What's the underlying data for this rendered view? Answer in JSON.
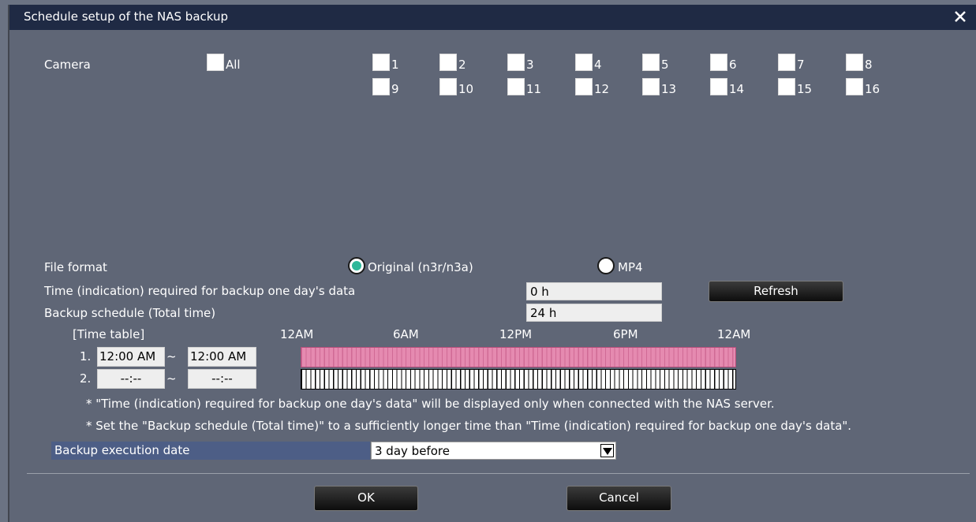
{
  "window": {
    "title": "Schedule setup of the NAS backup"
  },
  "camera": {
    "label": "Camera",
    "all_label": "All",
    "channels": [
      "1",
      "2",
      "3",
      "4",
      "5",
      "6",
      "7",
      "8",
      "9",
      "10",
      "11",
      "12",
      "13",
      "14",
      "15",
      "16"
    ]
  },
  "file_format": {
    "label": "File format",
    "options": [
      "Original (n3r/n3a)",
      "MP4"
    ],
    "selected": "Original (n3r/n3a)"
  },
  "time_required": {
    "label": "Time (indication) required for backup one day's data",
    "value": "0 h"
  },
  "refresh_label": "Refresh",
  "backup_schedule": {
    "label": "Backup schedule (Total time)",
    "value": "24 h"
  },
  "time_table": {
    "label": "[Time table]",
    "hour_labels": [
      "12AM",
      "6AM",
      "12PM",
      "6PM",
      "12AM"
    ],
    "rows": [
      {
        "num": "1.",
        "start": "12:00 AM",
        "sep": "~",
        "end": "12:00 AM"
      },
      {
        "num": "2.",
        "start": "--:--",
        "sep": "~",
        "end": "--:--"
      }
    ]
  },
  "notes": [
    "* \"Time (indication) required for backup one day's data\" will be displayed only when connected with the NAS server.",
    "* Set the \"Backup schedule (Total time)\" to a sufficiently longer time than \"Time (indication) required for backup one day's data\"."
  ],
  "execution_date": {
    "label": "Backup execution date",
    "value": "3 day before"
  },
  "buttons": {
    "ok": "OK",
    "cancel": "Cancel"
  },
  "colors": {
    "title_bar": "#1f2a44",
    "radio_selected": "#2fb89a",
    "schedule_on": "#e58ab0",
    "exec_label_bg": "#4d5e86"
  }
}
